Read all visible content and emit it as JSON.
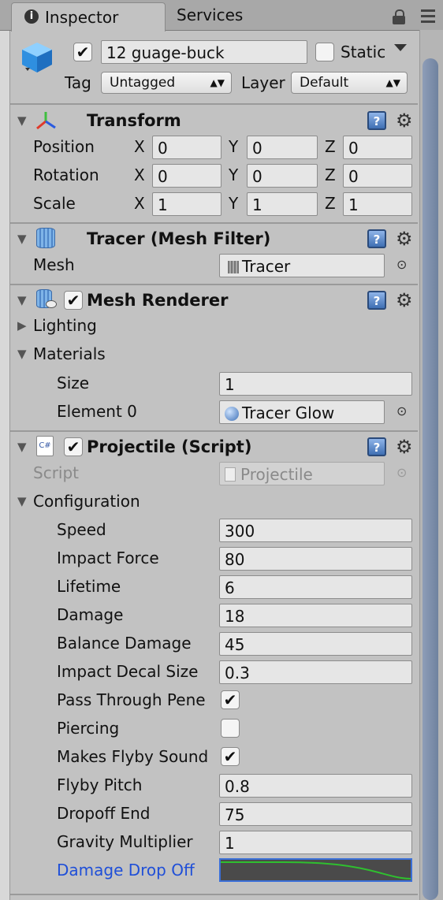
{
  "tabs": {
    "inspector": "Inspector",
    "services": "Services"
  },
  "header": {
    "object_name": "12 guage-buck",
    "active_checked": true,
    "static_label": "Static",
    "tag_label": "Tag",
    "tag_value": "Untagged",
    "layer_label": "Layer",
    "layer_value": "Default"
  },
  "transform": {
    "title": "Transform",
    "rows": [
      {
        "label": "Position",
        "x": "0",
        "y": "0",
        "z": "0"
      },
      {
        "label": "Rotation",
        "x": "0",
        "y": "0",
        "z": "0"
      },
      {
        "label": "Scale",
        "x": "1",
        "y": "1",
        "z": "1"
      }
    ],
    "axis_x": "X",
    "axis_y": "Y",
    "axis_z": "Z"
  },
  "mesh_filter": {
    "title": "Tracer (Mesh Filter)",
    "mesh_label": "Mesh",
    "mesh_value": "Tracer"
  },
  "mesh_renderer": {
    "title": "Mesh Renderer",
    "enabled": true,
    "lighting": "Lighting",
    "materials": "Materials",
    "size_label": "Size",
    "size_value": "1",
    "element0_label": "Element 0",
    "element0_value": "Tracer Glow"
  },
  "projectile": {
    "title": "Projectile (Script)",
    "enabled": true,
    "script_label": "Script",
    "script_value": "Projectile",
    "configuration": "Configuration",
    "speed_label": "Speed",
    "speed_value": "300",
    "impact_force_label": "Impact Force",
    "impact_force_value": "80",
    "lifetime_label": "Lifetime",
    "lifetime_value": "6",
    "damage_label": "Damage",
    "damage_value": "18",
    "balance_damage_label": "Balance Damage",
    "balance_damage_value": "45",
    "impact_decal_label": "Impact Decal Size",
    "impact_decal_value": "0.3",
    "pass_through_label": "Pass Through Pene",
    "piercing_label": "Piercing",
    "flyby_sound_label": "Makes Flyby Sound",
    "flyby_pitch_label": "Flyby Pitch",
    "flyby_pitch_value": "0.8",
    "dropoff_end_label": "Dropoff End",
    "dropoff_end_value": "75",
    "gravity_label": "Gravity Multiplier",
    "gravity_value": "1",
    "damage_drop_label": "Damage Drop Off"
  },
  "checkmark": "✔",
  "colors": {
    "accent_link": "#1f4fd8",
    "curve": "#2fbf2f",
    "curve_bg": "#4a4a4a"
  }
}
